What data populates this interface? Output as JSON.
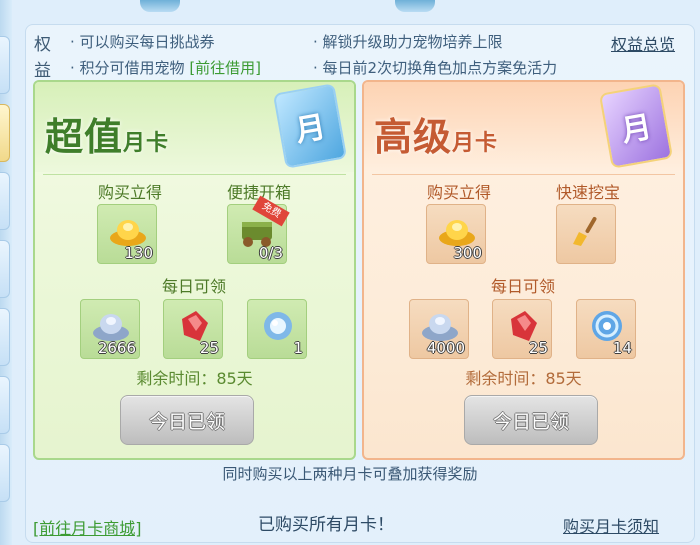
{
  "benefits": {
    "title_1": "权",
    "title_2": "益",
    "line1_a": "· 可以购买每日挑战券",
    "line1_b": "· 解锁升级助力宠物培养上限",
    "line2_a": "· 积分可借用宠物",
    "line2_a_link": "[前往借用]",
    "line2_b": "· 每日前2次切换角色加点方案免活力",
    "overview_link": "权益总览"
  },
  "cards": {
    "basic": {
      "title_big": "超值",
      "title_small": "月卡",
      "icon_char": "月",
      "buy_label": "购买立得",
      "extra_label": "便捷开箱",
      "buy_item": {
        "icon": "gold-ingot-icon",
        "count": "130"
      },
      "extra_item": {
        "icon": "treasure-cart-icon",
        "count": "0/3",
        "badge": "免费"
      },
      "daily_label": "每日可领",
      "daily_items": [
        {
          "icon": "silver-ingot-icon",
          "count": "2666"
        },
        {
          "icon": "red-crystal-icon",
          "count": "25"
        },
        {
          "icon": "magic-orb-icon",
          "count": "1"
        }
      ],
      "remaining": "剩余时间：85天",
      "claim_button": "今日已领"
    },
    "premium": {
      "title_big": "高级",
      "title_small": "月卡",
      "icon_char": "月",
      "buy_label": "购买立得",
      "extra_label": "快速挖宝",
      "buy_item": {
        "icon": "gold-ingot-icon",
        "count": "300"
      },
      "extra_item": {
        "icon": "shovel-icon",
        "count": ""
      },
      "daily_label": "每日可领",
      "daily_items": [
        {
          "icon": "silver-ingot-icon",
          "count": "4000"
        },
        {
          "icon": "red-crystal-icon",
          "count": "25"
        },
        {
          "icon": "swirl-orb-icon",
          "count": "14"
        }
      ],
      "remaining": "剩余时间：85天",
      "claim_button": "今日已领"
    }
  },
  "stack_note": "同时购买以上两种月卡可叠加获得奖励",
  "footer": {
    "shop_link": "[前往月卡商城]",
    "status": "已购买所有月卡！",
    "notice_link": "购买月卡须知"
  },
  "colors": {
    "basic_accent": "#3f7e2a",
    "premium_accent": "#c55b33",
    "link_green": "#3c9b33"
  }
}
